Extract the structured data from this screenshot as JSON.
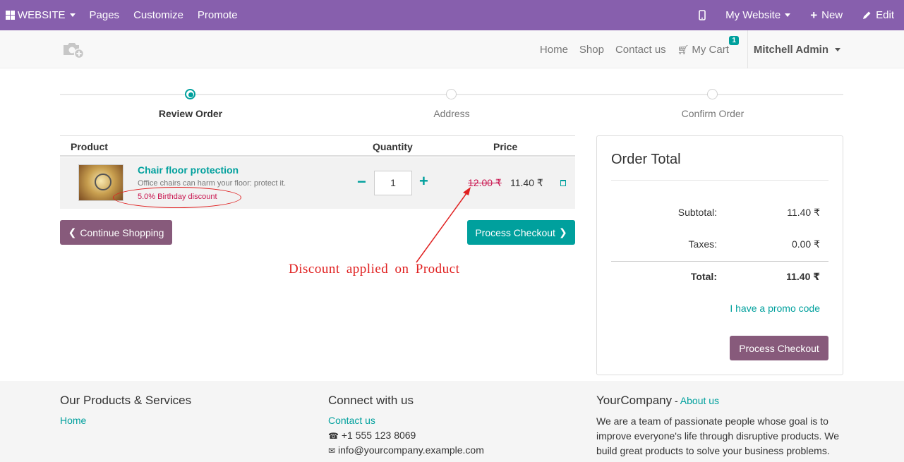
{
  "topbar": {
    "website_label": "WEBSITE",
    "pages_label": "Pages",
    "customize_label": "Customize",
    "promote_label": "Promote",
    "my_website_label": "My Website",
    "new_label": "New",
    "edit_label": "Edit"
  },
  "nav": {
    "home": "Home",
    "shop": "Shop",
    "contact": "Contact us",
    "cart": "My Cart",
    "cart_count": "1",
    "user": "Mitchell Admin"
  },
  "steps": [
    "Review Order",
    "Address",
    "Confirm Order"
  ],
  "cart": {
    "headers": {
      "product": "Product",
      "quantity": "Quantity",
      "price": "Price"
    },
    "item": {
      "name": "Chair floor protection",
      "description": "Office chairs can harm your floor: protect it.",
      "discount": "5.0% Birthday discount",
      "quantity": "1",
      "old_price": "12.00 ₹",
      "price": "11.40 ₹"
    },
    "continue_label": "Continue Shopping",
    "checkout_label": "Process Checkout"
  },
  "annotation": "Discount applied on Product",
  "order_total": {
    "title": "Order Total",
    "subtotal_label": "Subtotal:",
    "subtotal": "11.40 ₹",
    "taxes_label": "Taxes:",
    "taxes": "0.00 ₹",
    "total_label": "Total:",
    "total": "11.40 ₹",
    "promo_label": "I have a promo code",
    "checkout_label": "Process Checkout"
  },
  "footer": {
    "col1_title": "Our Products & Services",
    "col1_link": "Home",
    "col2_title": "Connect with us",
    "col2_link": "Contact us",
    "phone": "+1 555 123 8069",
    "email": "info@yourcompany.example.com",
    "col3_company": "YourCompany",
    "col3_sep": " - ",
    "col3_link": "About us",
    "about_text": "We are a team of passionate people whose goal is to improve everyone's life through disruptive products. We build great products to solve your business problems."
  },
  "colors": {
    "admin_bar": "#875fad",
    "primary": "#00a09d",
    "secondary": "#875a7b",
    "annotation": "#e02020"
  }
}
